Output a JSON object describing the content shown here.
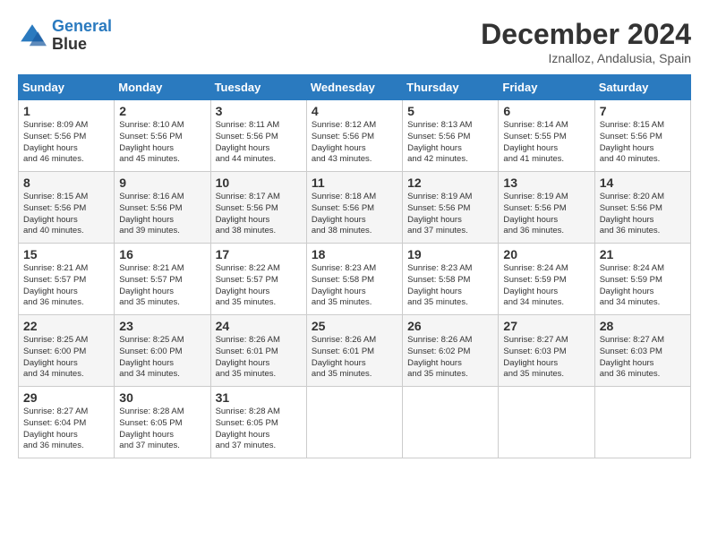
{
  "header": {
    "logo_line1": "General",
    "logo_line2": "Blue",
    "month": "December 2024",
    "location": "Iznalloz, Andalusia, Spain"
  },
  "weekdays": [
    "Sunday",
    "Monday",
    "Tuesday",
    "Wednesday",
    "Thursday",
    "Friday",
    "Saturday"
  ],
  "weeks": [
    [
      {
        "day": "1",
        "sunrise": "8:09 AM",
        "sunset": "5:56 PM",
        "daylight": "9 hours and 46 minutes."
      },
      {
        "day": "2",
        "sunrise": "8:10 AM",
        "sunset": "5:56 PM",
        "daylight": "9 hours and 45 minutes."
      },
      {
        "day": "3",
        "sunrise": "8:11 AM",
        "sunset": "5:56 PM",
        "daylight": "9 hours and 44 minutes."
      },
      {
        "day": "4",
        "sunrise": "8:12 AM",
        "sunset": "5:56 PM",
        "daylight": "9 hours and 43 minutes."
      },
      {
        "day": "5",
        "sunrise": "8:13 AM",
        "sunset": "5:56 PM",
        "daylight": "9 hours and 42 minutes."
      },
      {
        "day": "6",
        "sunrise": "8:14 AM",
        "sunset": "5:55 PM",
        "daylight": "9 hours and 41 minutes."
      },
      {
        "day": "7",
        "sunrise": "8:15 AM",
        "sunset": "5:56 PM",
        "daylight": "9 hours and 40 minutes."
      }
    ],
    [
      {
        "day": "8",
        "sunrise": "8:15 AM",
        "sunset": "5:56 PM",
        "daylight": "9 hours and 40 minutes."
      },
      {
        "day": "9",
        "sunrise": "8:16 AM",
        "sunset": "5:56 PM",
        "daylight": "9 hours and 39 minutes."
      },
      {
        "day": "10",
        "sunrise": "8:17 AM",
        "sunset": "5:56 PM",
        "daylight": "9 hours and 38 minutes."
      },
      {
        "day": "11",
        "sunrise": "8:18 AM",
        "sunset": "5:56 PM",
        "daylight": "9 hours and 38 minutes."
      },
      {
        "day": "12",
        "sunrise": "8:19 AM",
        "sunset": "5:56 PM",
        "daylight": "9 hours and 37 minutes."
      },
      {
        "day": "13",
        "sunrise": "8:19 AM",
        "sunset": "5:56 PM",
        "daylight": "9 hours and 36 minutes."
      },
      {
        "day": "14",
        "sunrise": "8:20 AM",
        "sunset": "5:56 PM",
        "daylight": "9 hours and 36 minutes."
      }
    ],
    [
      {
        "day": "15",
        "sunrise": "8:21 AM",
        "sunset": "5:57 PM",
        "daylight": "9 hours and 36 minutes."
      },
      {
        "day": "16",
        "sunrise": "8:21 AM",
        "sunset": "5:57 PM",
        "daylight": "9 hours and 35 minutes."
      },
      {
        "day": "17",
        "sunrise": "8:22 AM",
        "sunset": "5:57 PM",
        "daylight": "9 hours and 35 minutes."
      },
      {
        "day": "18",
        "sunrise": "8:23 AM",
        "sunset": "5:58 PM",
        "daylight": "9 hours and 35 minutes."
      },
      {
        "day": "19",
        "sunrise": "8:23 AM",
        "sunset": "5:58 PM",
        "daylight": "9 hours and 35 minutes."
      },
      {
        "day": "20",
        "sunrise": "8:24 AM",
        "sunset": "5:59 PM",
        "daylight": "9 hours and 34 minutes."
      },
      {
        "day": "21",
        "sunrise": "8:24 AM",
        "sunset": "5:59 PM",
        "daylight": "9 hours and 34 minutes."
      }
    ],
    [
      {
        "day": "22",
        "sunrise": "8:25 AM",
        "sunset": "6:00 PM",
        "daylight": "9 hours and 34 minutes."
      },
      {
        "day": "23",
        "sunrise": "8:25 AM",
        "sunset": "6:00 PM",
        "daylight": "9 hours and 34 minutes."
      },
      {
        "day": "24",
        "sunrise": "8:26 AM",
        "sunset": "6:01 PM",
        "daylight": "9 hours and 35 minutes."
      },
      {
        "day": "25",
        "sunrise": "8:26 AM",
        "sunset": "6:01 PM",
        "daylight": "9 hours and 35 minutes."
      },
      {
        "day": "26",
        "sunrise": "8:26 AM",
        "sunset": "6:02 PM",
        "daylight": "9 hours and 35 minutes."
      },
      {
        "day": "27",
        "sunrise": "8:27 AM",
        "sunset": "6:03 PM",
        "daylight": "9 hours and 35 minutes."
      },
      {
        "day": "28",
        "sunrise": "8:27 AM",
        "sunset": "6:03 PM",
        "daylight": "9 hours and 36 minutes."
      }
    ],
    [
      {
        "day": "29",
        "sunrise": "8:27 AM",
        "sunset": "6:04 PM",
        "daylight": "9 hours and 36 minutes."
      },
      {
        "day": "30",
        "sunrise": "8:28 AM",
        "sunset": "6:05 PM",
        "daylight": "9 hours and 37 minutes."
      },
      {
        "day": "31",
        "sunrise": "8:28 AM",
        "sunset": "6:05 PM",
        "daylight": "9 hours and 37 minutes."
      },
      null,
      null,
      null,
      null
    ]
  ]
}
